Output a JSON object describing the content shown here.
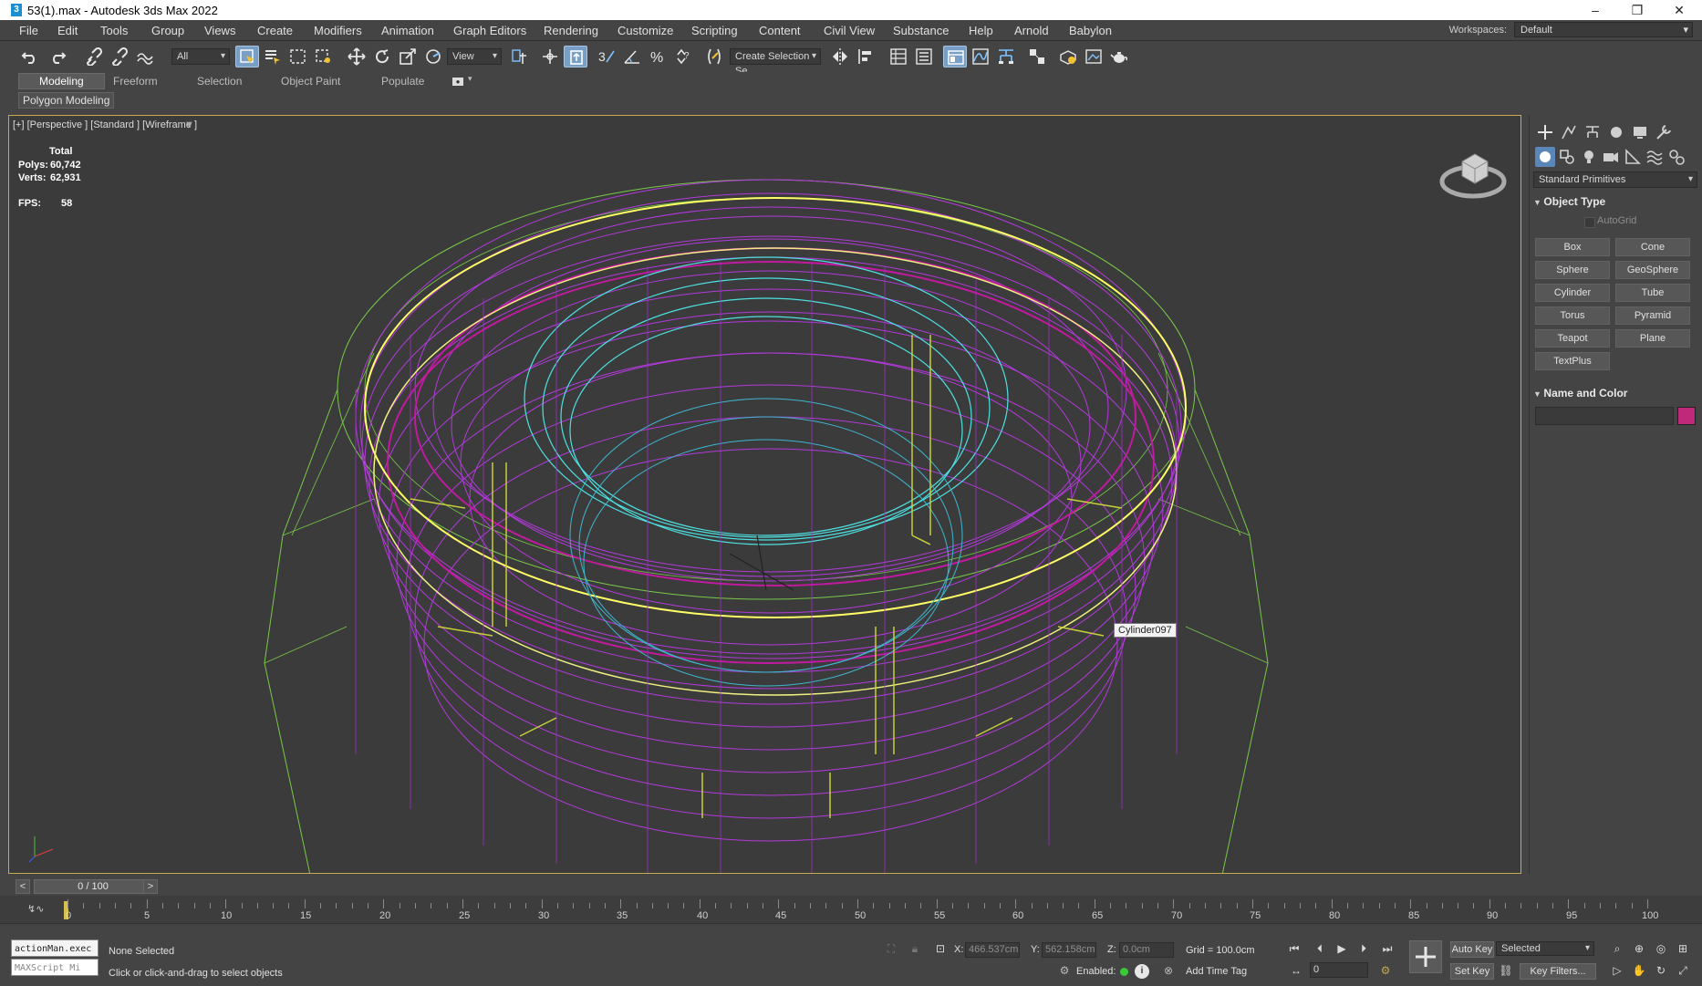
{
  "window": {
    "title": "53(1).max - Autodesk 3ds Max 2022",
    "app_icon": "3",
    "min": "–",
    "max": "❐",
    "close": "✕"
  },
  "menu": [
    "File",
    "Edit",
    "Tools",
    "Group",
    "Views",
    "Create",
    "Modifiers",
    "Animation",
    "Graph Editors",
    "Rendering",
    "Customize",
    "Scripting",
    "Content",
    "Civil View",
    "Substance",
    "Help",
    "Arnold",
    "Babylon"
  ],
  "workspace": {
    "label": "Workspaces:",
    "value": "Default"
  },
  "toolbar": {
    "selection_filter": "All",
    "ref_coord": "View",
    "named_selection": "Create Selection Se"
  },
  "ribbon": {
    "tabs": [
      "Modeling",
      "Freeform",
      "Selection",
      "Object Paint",
      "Populate"
    ],
    "active_tab": "Modeling",
    "panel_label": "Polygon Modeling"
  },
  "viewport": {
    "label": "[+] [Perspective ] [Standard ] [Wireframe ]",
    "stats_header": "Total",
    "polys_label": "Polys:",
    "polys_value": "60,742",
    "verts_label": "Verts:",
    "verts_value": "62,931",
    "fps_label": "FPS:",
    "fps_value": "58",
    "tooltip": "Cylinder097"
  },
  "command_panel": {
    "category": "Standard Primitives",
    "object_type_title": "Object Type",
    "autogrid": "AutoGrid",
    "buttons": [
      "Box",
      "Cone",
      "Sphere",
      "GeoSphere",
      "Cylinder",
      "Tube",
      "Torus",
      "Pyramid",
      "Teapot",
      "Plane",
      "TextPlus"
    ],
    "name_color_title": "Name and Color",
    "color_swatch": "#c0287a"
  },
  "timeline": {
    "slider": "0 / 100",
    "prev": "<",
    "next": ">",
    "labels": [
      "0",
      "5",
      "10",
      "15",
      "20",
      "25",
      "30",
      "35",
      "40",
      "45",
      "50",
      "55",
      "60",
      "65",
      "70",
      "75",
      "80",
      "85",
      "90",
      "95",
      "100"
    ]
  },
  "status": {
    "maxscript_top": "actionMan.exec",
    "maxscript_bottom": "MAXScript Mi",
    "selection": "None Selected",
    "prompt": "Click or click-and-drag to select objects",
    "x_label": "X:",
    "x_value": "466.537cm",
    "y_label": "Y:",
    "y_value": "562.158cm",
    "z_label": "Z:",
    "z_value": "0.0cm",
    "grid": "Grid = 100.0cm",
    "enabled": "Enabled:",
    "add_time_tag": "Add Time Tag",
    "frame_value": "0",
    "auto_key": "Auto Key",
    "set_key": "Set Key",
    "key_mode": "Selected",
    "key_filters": "Key Filters..."
  }
}
